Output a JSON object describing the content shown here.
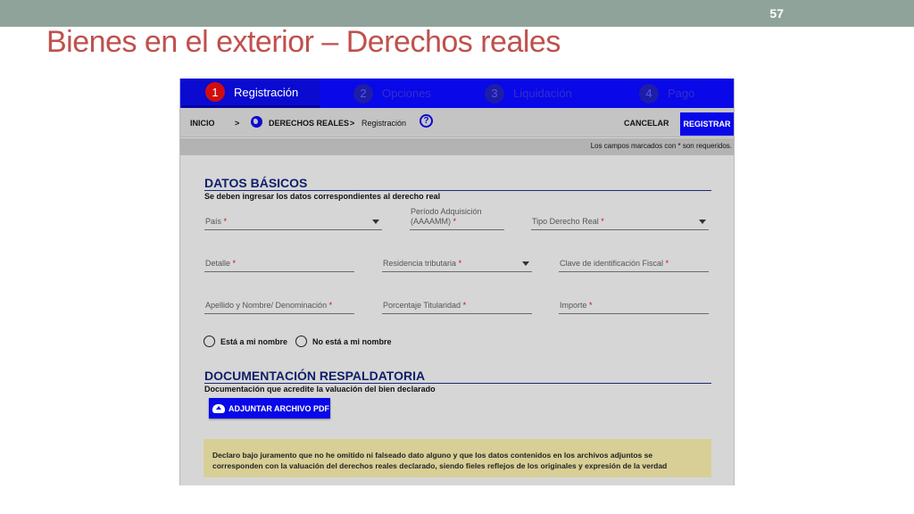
{
  "slide": {
    "number": "57",
    "title": "Bienes en el exterior – Derechos reales"
  },
  "steps": [
    {
      "num": "1",
      "label": "Registración"
    },
    {
      "num": "2",
      "label": "Opciones"
    },
    {
      "num": "3",
      "label": "Liquidación"
    },
    {
      "num": "4",
      "label": "Pago"
    }
  ],
  "nav": {
    "home": "INICIO",
    "sep": ">",
    "section": "DERECHOS REALES",
    "current": "Registración",
    "help": "?",
    "cancel": "CANCELAR",
    "register": "REGISTRAR"
  },
  "required_note": "Los campos marcados con * son requeridos.",
  "datos": {
    "title": "DATOS BÁSICOS",
    "subtitle": "Se deben ingresar los datos correspondientes al derecho real",
    "fields": {
      "pais": "País",
      "periodo_line1": "Período Adquisición",
      "periodo_line2": "(AAAAMM)",
      "tipo": "Tipo Derecho Real",
      "detalle": "Detalle",
      "residencia": "Residencia tributaria",
      "clave": "Clave de identificación Fiscal",
      "apellido": "Apellido y Nombre/ Denominación",
      "porcentaje": "Porcentaje Titularidad",
      "importe": "Importe"
    },
    "required_mark": "*",
    "radio_yes": "Está a mi nombre",
    "radio_no": "No está a mi nombre"
  },
  "doc": {
    "title": "DOCUMENTACIÓN RESPALDATORIA",
    "subtitle": "Documentación que acredite la valuación del bien declarado",
    "attach_label": "ADJUNTAR ARCHIVO PDF"
  },
  "declaration": "Declaro bajo juramento que no he omitido ni falseado dato alguno y que los datos contenidos en los archivos adjuntos se corresponden con la valuación del derechos reales declarado, siendo fieles reflejos de los originales y expresión de la verdad",
  "colors": {
    "title_red": "#c0504d",
    "blue": "#0808e8",
    "navy": "#0f1f6a",
    "required_red": "#d10d0d",
    "declaration_bg": "#d8cf96"
  }
}
